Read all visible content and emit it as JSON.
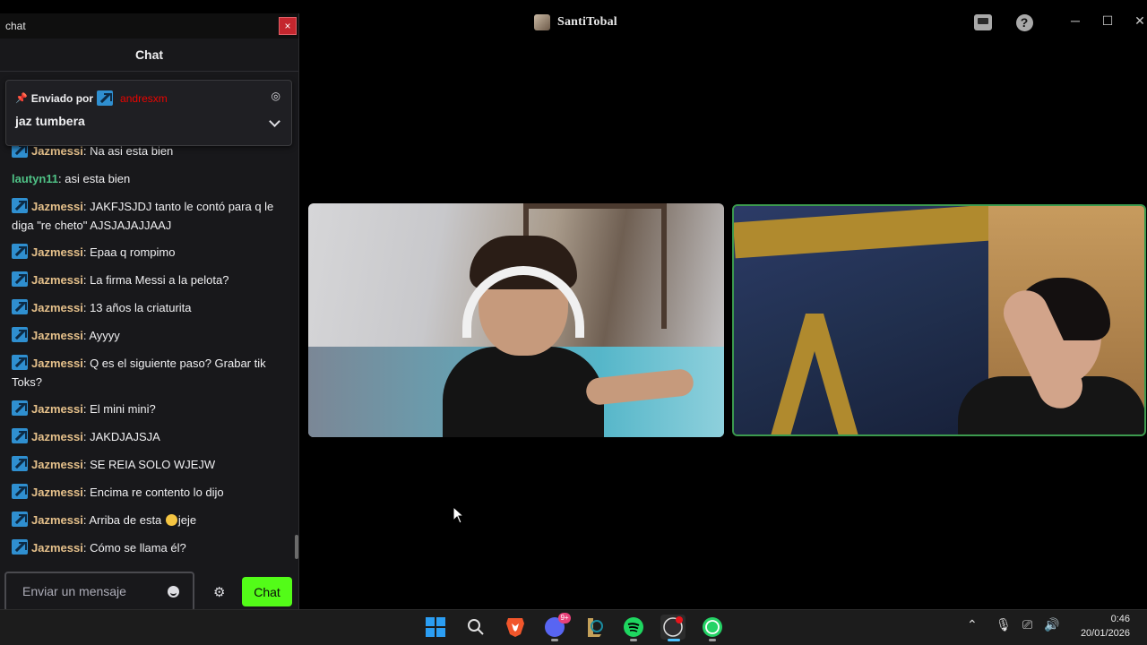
{
  "window": {
    "streamer_name": "SantiTobal",
    "controls": {
      "minimize": "─",
      "maximize": "☐",
      "close": "✕"
    },
    "toolbar_icons": [
      "inbox-icon",
      "help-icon"
    ],
    "help_glyph": "?"
  },
  "chat": {
    "window_title": "chat",
    "close_label": "×",
    "header_title": "Chat",
    "pinned": {
      "label": "Enviado por",
      "user": "andresxm",
      "message": "jaz tumbera"
    },
    "messages": [
      {
        "user": "Jazmessi",
        "sep": ":",
        "text": " Na asi esta bien",
        "badge": true
      },
      {
        "user": "lautyn11",
        "sep": ":",
        "text": " asi esta bien",
        "badge": false
      },
      {
        "user": "Jazmessi",
        "sep": ":",
        "text": " JAKFJSJDJ tanto le contó para q le diga \"re cheto\" AJSJAJAJJAAJ",
        "badge": true
      },
      {
        "user": "Jazmessi",
        "sep": ":",
        "text": " Epaa q rompimo",
        "badge": true
      },
      {
        "user": "Jazmessi",
        "sep": ":",
        "text": " La firma Messi a la pelota?",
        "badge": true
      },
      {
        "user": "Jazmessi",
        "sep": ":",
        "text": " 13 años la criaturita",
        "badge": true
      },
      {
        "user": "Jazmessi",
        "sep": ":",
        "text": " Ayyyy",
        "badge": true
      },
      {
        "user": "Jazmessi",
        "sep": ":",
        "text": " Q es el siguiente paso? Grabar tik Toks?",
        "badge": true
      },
      {
        "user": "Jazmessi",
        "sep": ":",
        "text": " El mini mini?",
        "badge": true
      },
      {
        "user": "Jazmessi",
        "sep": ":",
        "text": " JAKDJAJSJA",
        "badge": true
      },
      {
        "user": "Jazmessi",
        "sep": ":",
        "text": " SE REIA SOLO WJEJW",
        "badge": true
      },
      {
        "user": "Jazmessi",
        "sep": ":",
        "text": " Encima re contento lo dijo",
        "badge": true
      },
      {
        "user": "Jazmessi",
        "sep": ":",
        "text": " Arriba de esta ",
        "after_emoji": "jeje",
        "badge": true
      },
      {
        "user": "Jazmessi",
        "sep": ":",
        "text": " Cómo se llama él?",
        "badge": true
      }
    ],
    "input_placeholder": "Enviar un mensaje",
    "send_label": "Chat",
    "colors": {
      "send_button": "#53fc18",
      "pinned_user": "#eb0400",
      "user_jaz": "#e6c18b",
      "user_lau": "#4fc286"
    }
  },
  "taskbar": {
    "apps": [
      "windows-start-icon",
      "search-icon",
      "brave-icon",
      "discord-icon",
      "league-icon",
      "spotify-icon",
      "obs-icon",
      "whatsapp-icon"
    ],
    "discord_badge": "9+",
    "time": "0:46",
    "date": "20/01/2026"
  }
}
